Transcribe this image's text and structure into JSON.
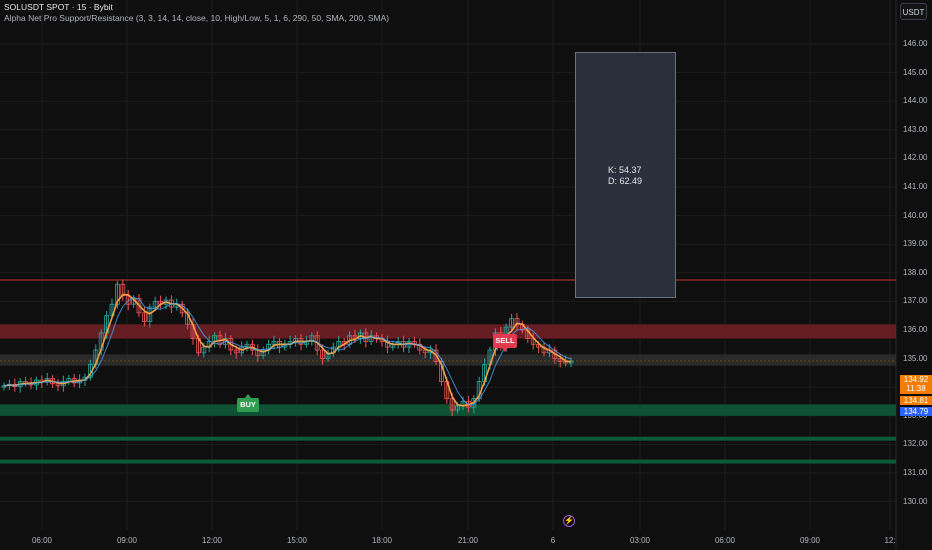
{
  "header": {
    "symbol": "SOLUSDT SPOT · 15 · Bybit",
    "indicator": "Alpha Net Pro Support/Resistance (3, 3, 14, 14, close, 10, High/Low, 5, 1, 6, 290, 50, SMA, 200, SMA)"
  },
  "currency_button": "USDT",
  "y_axis": {
    "ticks": [
      "146.00",
      "145.00",
      "144.00",
      "143.00",
      "142.00",
      "141.00",
      "140.00",
      "139.00",
      "138.00",
      "137.00",
      "136.00",
      "135.00",
      "134.00",
      "133.00",
      "132.00",
      "131.00",
      "130.00"
    ],
    "values": [
      146,
      145,
      144,
      143,
      142,
      141,
      140,
      139,
      138,
      137,
      136,
      135,
      134,
      133,
      132,
      131,
      130
    ]
  },
  "x_axis": {
    "labels": [
      "06:00",
      "09:00",
      "12:00",
      "15:00",
      "18:00",
      "21:00",
      "6",
      "03:00",
      "06:00",
      "09:00",
      "12:"
    ]
  },
  "price_tags": {
    "last_price": "134.92",
    "countdown": "11:38",
    "level_1": "134.81",
    "level_2": "134.79"
  },
  "tooltip": {
    "k": "K: 54.37",
    "d": "D: 62.49"
  },
  "signals": {
    "buy": "BUY",
    "sell": "SELL"
  },
  "zones": {
    "resistance_line": 137.75,
    "resistance_zone": [
      135.7,
      136.2
    ],
    "mid_zone": [
      134.75,
      134.95
    ],
    "support_zone": [
      133.0,
      133.4
    ],
    "support_line_1": 132.2,
    "support_line_2": 131.4
  },
  "colors": {
    "background": "#0f0f0f",
    "up": "#26a69a",
    "down": "#ef5350",
    "ma_fast": "#f0a04b",
    "ma_slow": "#42a5f5",
    "resistance": "#7a1f28",
    "support": "#0d5a38",
    "tag_orange": "#f57c00",
    "tag_blue": "#2962ff"
  },
  "chart_data": {
    "type": "candlestick",
    "closes": [
      134.05,
      134.1,
      134.02,
      134.2,
      134.15,
      134.08,
      134.25,
      134.18,
      134.3,
      134.12,
      134.05,
      134.2,
      134.3,
      134.15,
      134.25,
      134.35,
      134.8,
      135.3,
      135.9,
      136.5,
      136.9,
      137.6,
      137.2,
      136.9,
      137.1,
      136.6,
      136.3,
      136.8,
      137.0,
      136.9,
      137.05,
      136.8,
      136.9,
      136.6,
      136.2,
      135.7,
      135.2,
      135.4,
      135.6,
      135.8,
      135.5,
      135.7,
      135.3,
      135.2,
      135.4,
      135.5,
      135.3,
      135.1,
      135.3,
      135.5,
      135.6,
      135.4,
      135.5,
      135.6,
      135.7,
      135.5,
      135.6,
      135.8,
      135.3,
      135.0,
      135.2,
      135.4,
      135.6,
      135.5,
      135.8,
      135.7,
      135.9,
      135.6,
      135.8,
      135.7,
      135.6,
      135.4,
      135.5,
      135.6,
      135.4,
      135.6,
      135.5,
      135.3,
      135.2,
      135.3,
      134.9,
      134.2,
      133.6,
      133.2,
      133.35,
      133.5,
      133.3,
      133.6,
      134.2,
      134.8,
      135.3,
      135.9,
      135.4,
      136.1,
      136.4,
      136.2,
      136.0,
      135.7,
      135.5,
      135.4,
      135.2,
      135.3,
      135.0,
      134.9,
      134.85,
      134.92
    ]
  }
}
